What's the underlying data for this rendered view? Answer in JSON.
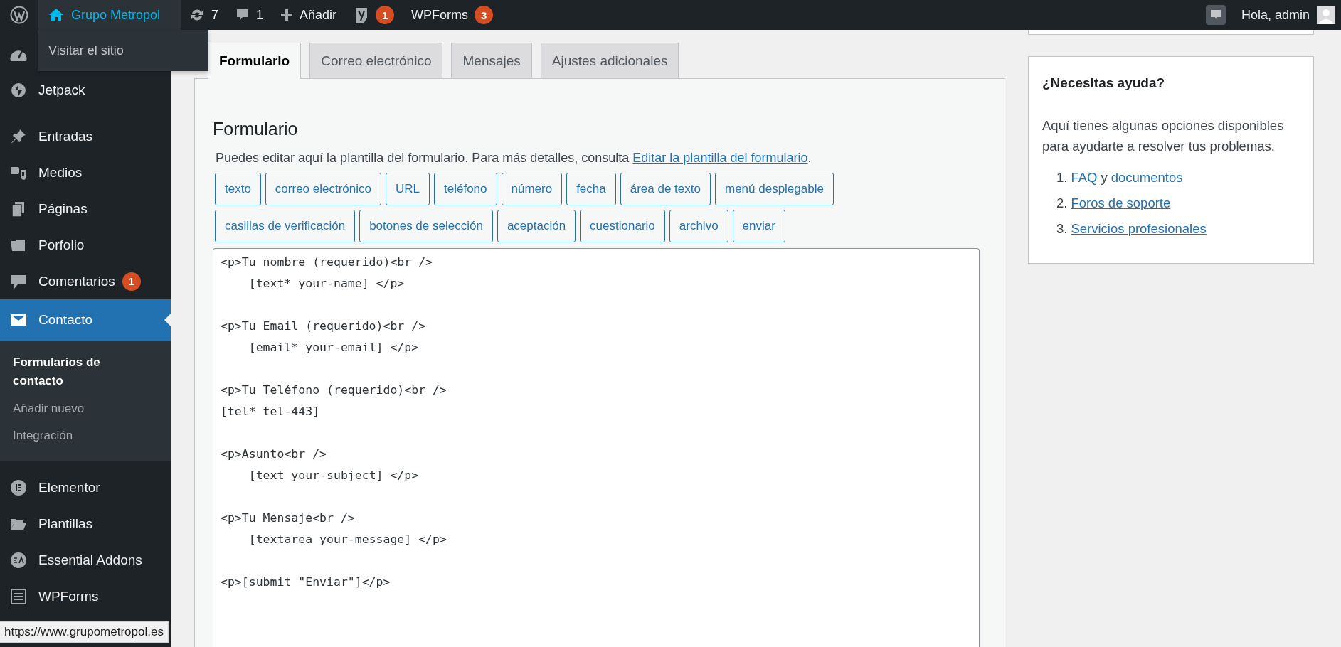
{
  "admin_bar": {
    "site": "Grupo Metropol",
    "site_menu": [
      "Visitar el sitio"
    ],
    "updates": "7",
    "comments": "1",
    "new": "Añadir",
    "seo_badge": "1",
    "wpforms": {
      "label": "WPForms",
      "badge": "3"
    },
    "greeting": "Hola, admin"
  },
  "sidebar": {
    "items": [
      {
        "kind": "dashboard",
        "selected": false
      },
      {
        "kind": "jetpack",
        "label": "Jetpack",
        "selected": false
      },
      {
        "kind": "pin",
        "label": "Entradas",
        "selected": false
      },
      {
        "kind": "media",
        "label": "Medios",
        "selected": false
      },
      {
        "kind": "pages",
        "label": "Páginas",
        "selected": false
      },
      {
        "kind": "folder",
        "label": "Porfolio",
        "selected": false
      },
      {
        "kind": "comment",
        "label": "Comentarios",
        "badge": "1",
        "selected": false
      },
      {
        "kind": "mail",
        "label": "Contacto",
        "selected": true,
        "children": [
          {
            "label": "Formularios de contacto",
            "selected": true
          },
          {
            "label": "Añadir nuevo",
            "selected": false
          },
          {
            "label": "Integración",
            "selected": false
          }
        ]
      },
      {
        "kind": "elementor",
        "label": "Elementor",
        "selected": false
      },
      {
        "kind": "folder-open",
        "label": "Plantillas",
        "selected": false
      },
      {
        "kind": "ea",
        "label": "Essential Addons",
        "selected": false
      },
      {
        "kind": "form",
        "label": "WPForms",
        "selected": false
      }
    ]
  },
  "tabs": [
    {
      "label": "Formulario",
      "selected": true
    },
    {
      "label": "Correo electrónico",
      "selected": false
    },
    {
      "label": "Mensajes",
      "selected": false
    },
    {
      "label": "Ajustes adicionales",
      "selected": false
    }
  ],
  "form": {
    "heading": "Formulario",
    "description": "Puedes editar aquí la plantilla del formulario. Para más detalles, consulta",
    "link": "Editar la plantilla del formulario",
    "after": ".",
    "tag_rows": [
      [
        "texto",
        "correo electrónico",
        "URL",
        "teléfono",
        "número",
        "fecha",
        "área de texto",
        "menú desplegable"
      ],
      [
        "casillas de verificación",
        "botones de selección",
        "aceptación",
        "cuestionario",
        "archivo",
        "enviar"
      ]
    ],
    "code": "<p>Tu nombre (requerido)<br />\n    [text* your-name] </p>\n\n<p>Tu Email (requerido)<br />\n    [email* your-email] </p>\n\n<p>Tu Teléfono (requerido)<br />\n[tel* tel-443]\n\n<p>Asunto<br />\n    [text your-subject] </p>\n\n<p>Tu Mensaje<br />\n    [textarea your-message] </p>\n\n<p>[submit \"Enviar\"]</p>"
  },
  "help": {
    "title": "¿Necesitas ayuda?",
    "text": "Aquí tienes algunas opciones disponibles para ayudarte a resolver tus problemas.",
    "items": [
      {
        "number": "1.",
        "links": [
          "FAQ",
          "documentos"
        ],
        "joiner": "y"
      },
      {
        "number": "2.",
        "links": [
          "Foros de soporte"
        ]
      },
      {
        "number": "3.",
        "links": [
          "Servicios profesionales"
        ]
      }
    ]
  },
  "status_url": "https://www.grupometropol.es"
}
